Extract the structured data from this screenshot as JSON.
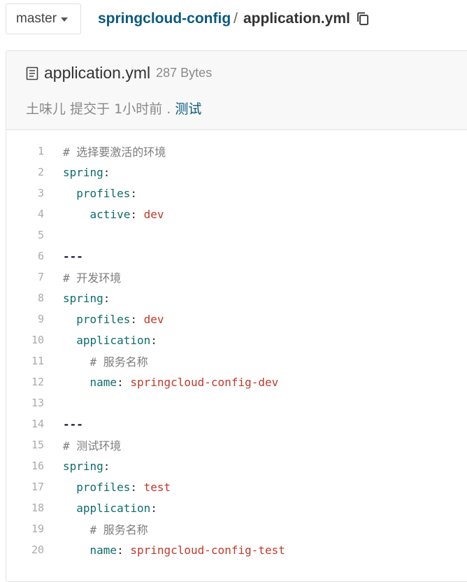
{
  "breadcrumb": {
    "branch": "master",
    "repo": "springcloud-config",
    "separator": "/",
    "file": "application.yml"
  },
  "file": {
    "name": "application.yml",
    "size": "287 Bytes",
    "commit": {
      "author": "土味儿",
      "action": "提交于",
      "time": "1小时前",
      "dot": ".",
      "message": "测试"
    }
  },
  "code": {
    "lines": [
      {
        "n": "1",
        "indent": "",
        "segs": [
          {
            "t": "# 选择要激活的环境",
            "c": "cmt"
          }
        ]
      },
      {
        "n": "2",
        "indent": "",
        "segs": [
          {
            "t": "spring",
            "c": "key"
          },
          {
            "t": ":",
            "c": "punc"
          }
        ]
      },
      {
        "n": "3",
        "indent": "  ",
        "segs": [
          {
            "t": "profiles",
            "c": "key"
          },
          {
            "t": ":",
            "c": "punc"
          }
        ]
      },
      {
        "n": "4",
        "indent": "    ",
        "segs": [
          {
            "t": "active",
            "c": "key"
          },
          {
            "t": ": ",
            "c": "punc"
          },
          {
            "t": "dev",
            "c": "val"
          }
        ]
      },
      {
        "n": "5",
        "indent": "",
        "segs": []
      },
      {
        "n": "6",
        "indent": "",
        "segs": [
          {
            "t": "---",
            "c": "doc"
          }
        ]
      },
      {
        "n": "7",
        "indent": "",
        "segs": [
          {
            "t": "# 开发环境",
            "c": "cmt"
          }
        ]
      },
      {
        "n": "8",
        "indent": "",
        "segs": [
          {
            "t": "spring",
            "c": "key"
          },
          {
            "t": ":",
            "c": "punc"
          }
        ]
      },
      {
        "n": "9",
        "indent": "  ",
        "segs": [
          {
            "t": "profiles",
            "c": "key"
          },
          {
            "t": ": ",
            "c": "punc"
          },
          {
            "t": "dev",
            "c": "val"
          }
        ]
      },
      {
        "n": "10",
        "indent": "  ",
        "segs": [
          {
            "t": "application",
            "c": "key"
          },
          {
            "t": ":",
            "c": "punc"
          }
        ]
      },
      {
        "n": "11",
        "indent": "    ",
        "segs": [
          {
            "t": "# 服务名称",
            "c": "cmt"
          }
        ]
      },
      {
        "n": "12",
        "indent": "    ",
        "segs": [
          {
            "t": "name",
            "c": "key"
          },
          {
            "t": ": ",
            "c": "punc"
          },
          {
            "t": "springcloud-config-dev",
            "c": "val"
          }
        ]
      },
      {
        "n": "13",
        "indent": "",
        "segs": []
      },
      {
        "n": "14",
        "indent": "",
        "segs": [
          {
            "t": "---",
            "c": "doc"
          }
        ]
      },
      {
        "n": "15",
        "indent": "",
        "segs": [
          {
            "t": "# 测试环境",
            "c": "cmt"
          }
        ]
      },
      {
        "n": "16",
        "indent": "",
        "segs": [
          {
            "t": "spring",
            "c": "key"
          },
          {
            "t": ":",
            "c": "punc"
          }
        ]
      },
      {
        "n": "17",
        "indent": "  ",
        "segs": [
          {
            "t": "profiles",
            "c": "key"
          },
          {
            "t": ": ",
            "c": "punc"
          },
          {
            "t": "test",
            "c": "val"
          }
        ]
      },
      {
        "n": "18",
        "indent": "  ",
        "segs": [
          {
            "t": "application",
            "c": "key"
          },
          {
            "t": ":",
            "c": "punc"
          }
        ]
      },
      {
        "n": "19",
        "indent": "    ",
        "segs": [
          {
            "t": "# 服务名称",
            "c": "cmt"
          }
        ]
      },
      {
        "n": "20",
        "indent": "    ",
        "segs": [
          {
            "t": "name",
            "c": "key"
          },
          {
            "t": ": ",
            "c": "punc"
          },
          {
            "t": "springcloud-config-test",
            "c": "val"
          }
        ]
      }
    ]
  },
  "icons": {
    "copy": "copy-icon",
    "file": "file-text-icon",
    "branch_caret": "caret-down-icon"
  },
  "colors": {
    "link": "#0b5a7e",
    "key": "#0f6b6b",
    "value": "#c0392b",
    "comment": "#7d7d7d"
  }
}
